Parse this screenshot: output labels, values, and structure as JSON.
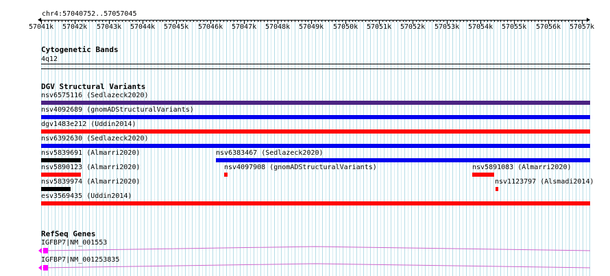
{
  "location": "chr4:57040752..57057045",
  "ruler_ticks": [
    "57041k",
    "57042k",
    "57043k",
    "57044k",
    "57045k",
    "57046k",
    "57047k",
    "57048k",
    "57049k",
    "57050k",
    "57051k",
    "57052k",
    "57053k",
    "57054k",
    "57055k",
    "57056k",
    "57057k"
  ],
  "cytoband": {
    "title": "Cytogenetic Bands",
    "band": "4q12"
  },
  "dgv": {
    "title": "DGV Structural Variants",
    "variants": [
      {
        "label": "nsv6575116 (Sedlazeck2020)",
        "color": "#4b2382"
      },
      {
        "label": "nsv4092689 (gnomADStructuralVariants)",
        "color": "#0000ee"
      },
      {
        "label": "dgv1483e212 (Uddin2014)",
        "color": "#ff0000"
      },
      {
        "label": "nsv6392630 (Sedlazeck2020)",
        "color": "#0000ee"
      },
      {
        "label": "nsv5839691 (Almarri2020)",
        "color": "#000000"
      },
      {
        "label": "nsv6383467 (Sedlazeck2020)",
        "color": "#0000ee"
      },
      {
        "label": "nsv5890123 (Almarri2020)",
        "color": "#ff0000"
      },
      {
        "label": "nsv4097908 (gnomADStructuralVariants)",
        "color": "#ff0000"
      },
      {
        "label": "nsv5891083 (Almarri2020)",
        "color": "#ff0000"
      },
      {
        "label": "nsv5839974 (Almarri2020)",
        "color": "#000000"
      },
      {
        "label": "nsv1123797 (Alsmadi2014)",
        "color": "#ff0000"
      },
      {
        "label": "esv3569435 (Uddin2014)",
        "color": "#ff0000"
      }
    ]
  },
  "refseq": {
    "title": "RefSeq Genes",
    "genes": [
      {
        "label": "IGFBP7|NM_001553",
        "color": "#ff00ff"
      },
      {
        "label": "IGFBP7|NM_001253835",
        "color": "#ff00ff"
      }
    ]
  }
}
